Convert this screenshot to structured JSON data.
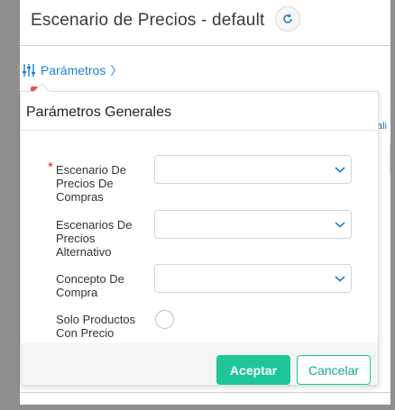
{
  "header": {
    "title": "Escenario de Precios - default",
    "refresh_icon": "refresh-icon"
  },
  "breadcrumb": {
    "label": "Parámetros",
    "chevron": "〉",
    "icon": "sliders-icon"
  },
  "background": {
    "cut_text": "ali"
  },
  "popover": {
    "title": "Parámetros Generales",
    "fields": [
      {
        "label": "Escenario De Precios De Compras",
        "required": true,
        "value": ""
      },
      {
        "label": "Escenarios De Precios Alternativo",
        "required": false,
        "value": ""
      },
      {
        "label": "Concepto De Compra",
        "required": false,
        "value": ""
      },
      {
        "label": "Solo Productos Con Precio",
        "type": "radio",
        "checked": false
      }
    ],
    "required_mark": "*",
    "buttons": {
      "accept": "Aceptar",
      "cancel": "Cancelar"
    }
  },
  "colors": {
    "accent_green": "#1ec69a",
    "link_blue": "#1f7fd1",
    "required_red": "#e02424",
    "frame_gray": "#8f8f8f"
  }
}
